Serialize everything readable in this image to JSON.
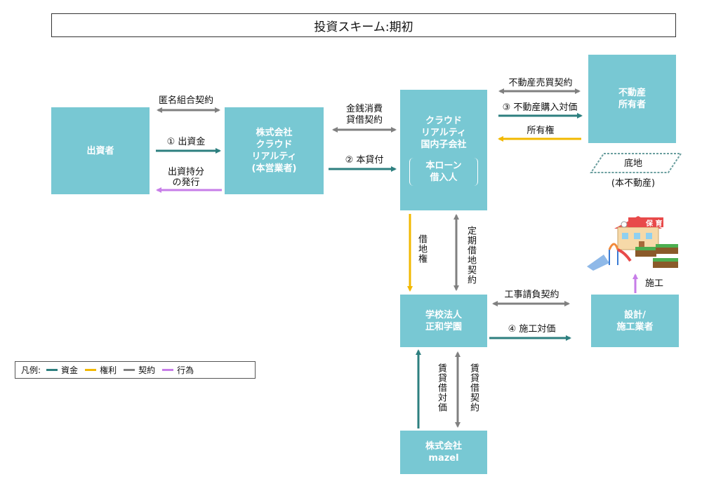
{
  "title": "投資スキーム:期初",
  "colors": {
    "fund": "#2d7f7f",
    "right": "#f2b800",
    "contract": "#808080",
    "act": "#c77ee8",
    "box": "#78c8d3"
  },
  "nodes": {
    "investor": "出資者",
    "operator": [
      "株式会社",
      "クラウド",
      "リアルティ",
      "(本営業者)"
    ],
    "subsidiary": [
      "クラウド",
      "リアルティ",
      "国内子会社"
    ],
    "borrower": [
      "本ローン",
      "借入人"
    ],
    "owner": [
      "不動産",
      "所有者"
    ],
    "school": [
      "学校法人",
      "正和学園"
    ],
    "builder": [
      "設計/",
      "施工業者"
    ],
    "mazel": [
      "株式会社",
      "mazel"
    ],
    "land": "底地",
    "land_note": "(本不動産)"
  },
  "labels": {
    "tokumei": "匿名組合契約",
    "investment": "① 出資金",
    "equity": [
      "出資持分",
      "の発行"
    ],
    "loan_contract": [
      "金銭消費",
      "貸借契約"
    ],
    "loan": "② 本貸付",
    "sale_contract": "不動産売買契約",
    "purchase": "③ 不動産購入対価",
    "ownership": "所有権",
    "leasehold": "借地権",
    "fixed_lease": "定期借地契約",
    "construction_contract": "工事請負契約",
    "construction_fee": "④ 施工対価",
    "construction": "施工",
    "rent_fee": "賃貸借対価",
    "rent_contract": "賃貸借契約",
    "nursery_sign": "保 育"
  },
  "legend": {
    "prefix": "凡例:",
    "fund": "資金",
    "right": "権利",
    "contract": "契約",
    "act": "行為"
  }
}
